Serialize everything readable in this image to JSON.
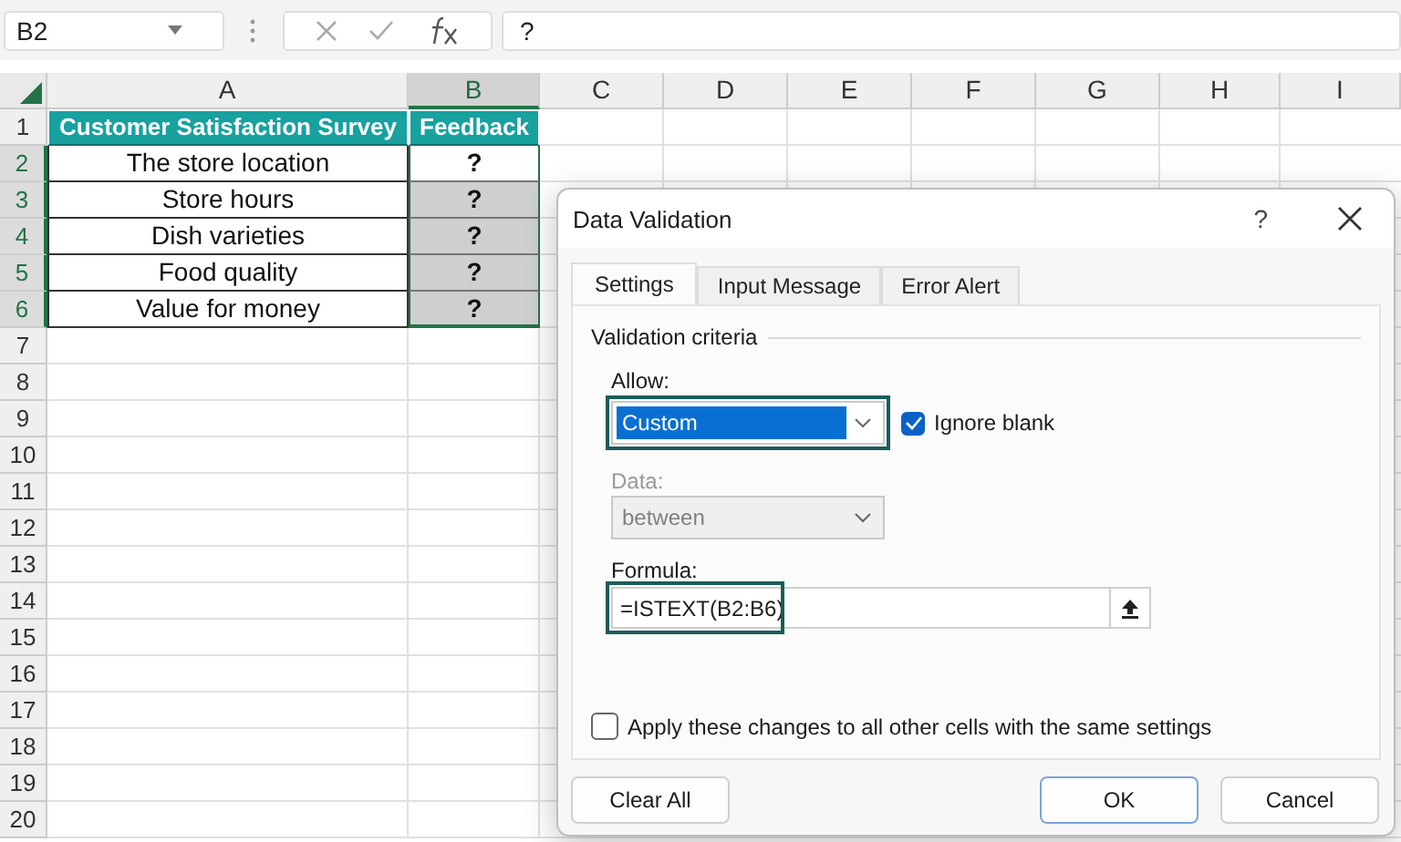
{
  "name_box": {
    "value": "B2"
  },
  "formula_bar": {
    "value": "?"
  },
  "columns": [
    {
      "label": "A",
      "selected": false
    },
    {
      "label": "B",
      "selected": true
    },
    {
      "label": "C",
      "selected": false
    },
    {
      "label": "D",
      "selected": false
    },
    {
      "label": "E",
      "selected": false
    },
    {
      "label": "F",
      "selected": false
    },
    {
      "label": "G",
      "selected": false
    },
    {
      "label": "H",
      "selected": false
    },
    {
      "label": "I",
      "selected": false
    }
  ],
  "rows": [
    {
      "number": "1",
      "selected": false,
      "cells": [
        {
          "text": "Customer Satisfaction Survey",
          "kind": "header",
          "selected": false
        },
        {
          "text": "Feedback",
          "kind": "header",
          "selected": false
        }
      ]
    },
    {
      "number": "2",
      "selected": true,
      "cells": [
        {
          "text": "The store location",
          "kind": "data",
          "selected": false
        },
        {
          "text": "?",
          "kind": "data",
          "selected": true,
          "active": true
        }
      ]
    },
    {
      "number": "3",
      "selected": true,
      "cells": [
        {
          "text": "Store hours",
          "kind": "data",
          "selected": false
        },
        {
          "text": "?",
          "kind": "data",
          "selected": true,
          "active": false
        }
      ]
    },
    {
      "number": "4",
      "selected": true,
      "cells": [
        {
          "text": "Dish varieties",
          "kind": "data",
          "selected": false
        },
        {
          "text": "?",
          "kind": "data",
          "selected": true,
          "active": false
        }
      ]
    },
    {
      "number": "5",
      "selected": true,
      "cells": [
        {
          "text": "Food quality",
          "kind": "data",
          "selected": false
        },
        {
          "text": "?",
          "kind": "data",
          "selected": true,
          "active": false
        }
      ]
    },
    {
      "number": "6",
      "selected": true,
      "cells": [
        {
          "text": "Value for money",
          "kind": "data",
          "selected": false
        },
        {
          "text": "?",
          "kind": "data",
          "selected": true,
          "active": false
        }
      ]
    },
    {
      "number": "7",
      "selected": false
    },
    {
      "number": "8",
      "selected": false
    },
    {
      "number": "9",
      "selected": false
    },
    {
      "number": "10",
      "selected": false
    },
    {
      "number": "11",
      "selected": false
    },
    {
      "number": "12",
      "selected": false
    },
    {
      "number": "13",
      "selected": false
    },
    {
      "number": "14",
      "selected": false
    },
    {
      "number": "15",
      "selected": false
    },
    {
      "number": "16",
      "selected": false
    },
    {
      "number": "17",
      "selected": false
    },
    {
      "number": "18",
      "selected": false
    },
    {
      "number": "19",
      "selected": false
    },
    {
      "number": "20",
      "selected": false
    }
  ],
  "dialog": {
    "title": "Data Validation",
    "help_button": "?",
    "tabs": [
      {
        "label": "Settings",
        "selected": true
      },
      {
        "label": "Input Message",
        "selected": false
      },
      {
        "label": "Error Alert",
        "selected": false
      }
    ],
    "group_title": "Validation criteria",
    "allow": {
      "label": "Allow:",
      "value": "Custom",
      "highlighted": true
    },
    "ignore_blank": {
      "label": "Ignore blank",
      "checked": true
    },
    "data": {
      "label": "Data:",
      "value": "between",
      "disabled": true
    },
    "formula": {
      "label": "Formula:",
      "value": "=ISTEXT(B2:B6)",
      "highlighted": true
    },
    "apply_all": {
      "label": "Apply these changes to all other cells with the same settings",
      "checked": false
    },
    "buttons": [
      {
        "label": "Clear All",
        "kind": "left",
        "default": false
      },
      {
        "label": "OK",
        "kind": "right",
        "default": true
      },
      {
        "label": "Cancel",
        "kind": "right",
        "default": false
      }
    ]
  }
}
